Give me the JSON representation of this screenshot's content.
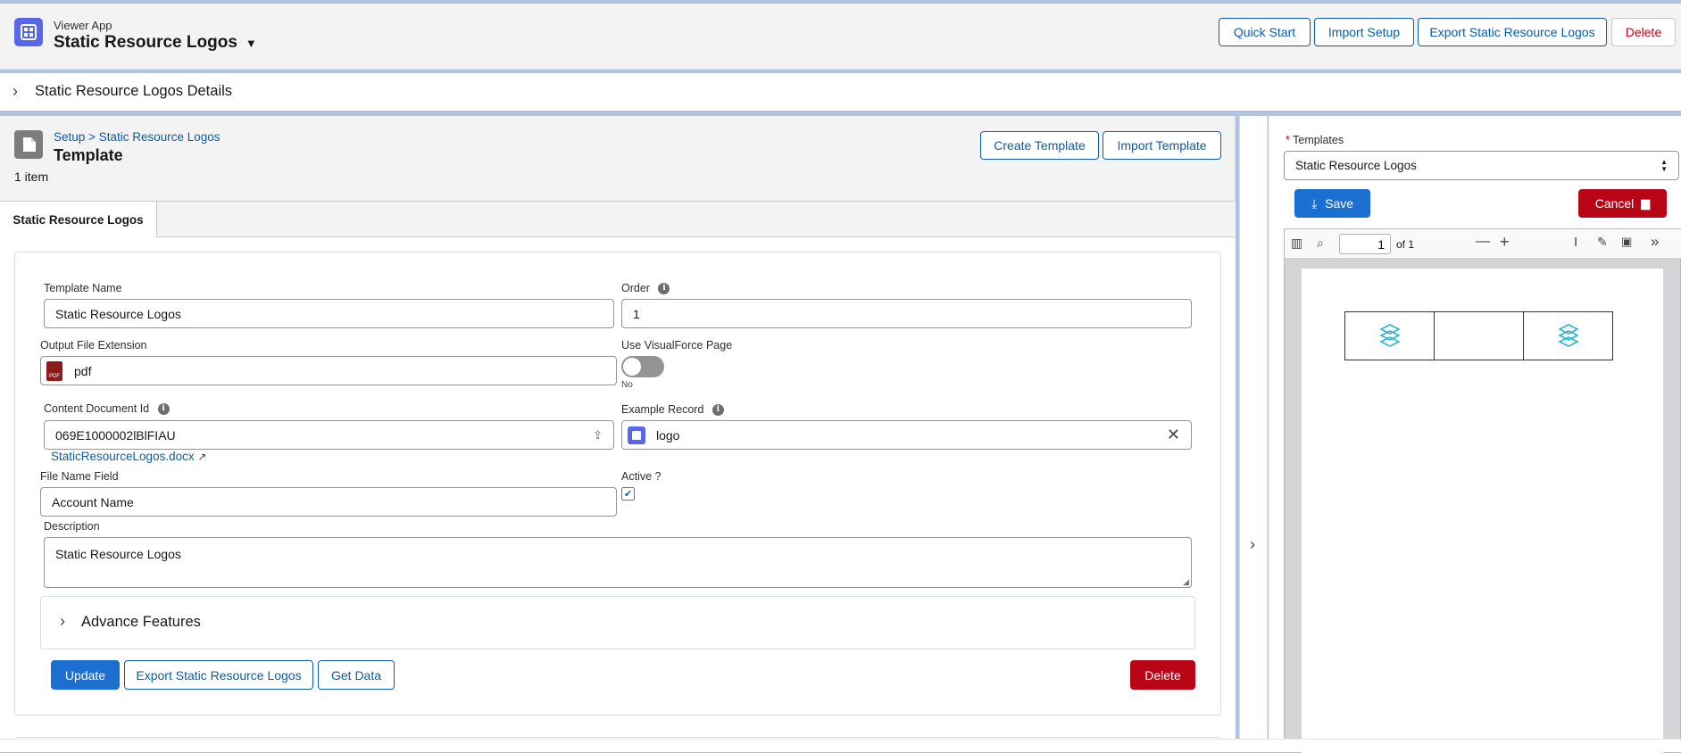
{
  "header": {
    "app_label": "Viewer App",
    "title": "Static Resource Logos",
    "buttons": {
      "quick_start": "Quick Start",
      "import_setup": "Import Setup",
      "export": "Export Static Resource Logos",
      "delete": "Delete"
    }
  },
  "details_section": {
    "title": "Static Resource Logos Details"
  },
  "template_card": {
    "breadcrumb": {
      "setup": "Setup",
      "sep": ">",
      "current": "Static Resource Logos"
    },
    "title": "Template",
    "count": "1 item",
    "buttons": {
      "create": "Create Template",
      "import": "Import Template"
    },
    "tab_label": "Static Resource Logos"
  },
  "form": {
    "template_name": {
      "label": "Template Name",
      "value": "Static Resource Logos"
    },
    "order": {
      "label": "Order",
      "value": "1"
    },
    "output_ext": {
      "label": "Output File Extension",
      "value": "pdf",
      "icon_text": "PDF"
    },
    "use_vf": {
      "label": "Use VisualForce Page",
      "state": "No"
    },
    "content_doc": {
      "label": "Content Document Id",
      "value": "069E1000002lBlFIAU",
      "link": "StaticResourceLogos.docx"
    },
    "example_record": {
      "label": "Example Record",
      "value": "logo"
    },
    "file_name_field": {
      "label": "File Name Field",
      "value": "Account Name"
    },
    "active": {
      "label": "Active ?"
    },
    "description": {
      "label": "Description",
      "value": "Static Resource Logos"
    },
    "advance": {
      "label": "Advance Features"
    },
    "buttons": {
      "update": "Update",
      "export": "Export Static Resource Logos",
      "get_data": "Get Data",
      "delete": "Delete"
    }
  },
  "right_panel": {
    "templates_label": "Templates",
    "required_mark": "*",
    "templates_value": "Static Resource Logos",
    "save": "Save",
    "cancel": "Cancel",
    "pdf": {
      "page": "1",
      "of": "of 1"
    }
  },
  "colors": {
    "brand": "#1b6fd1",
    "danger": "#ba0517",
    "link": "#0b5cab",
    "app_icon": "#5867e8",
    "logo_teal": "#2bb5c8"
  }
}
